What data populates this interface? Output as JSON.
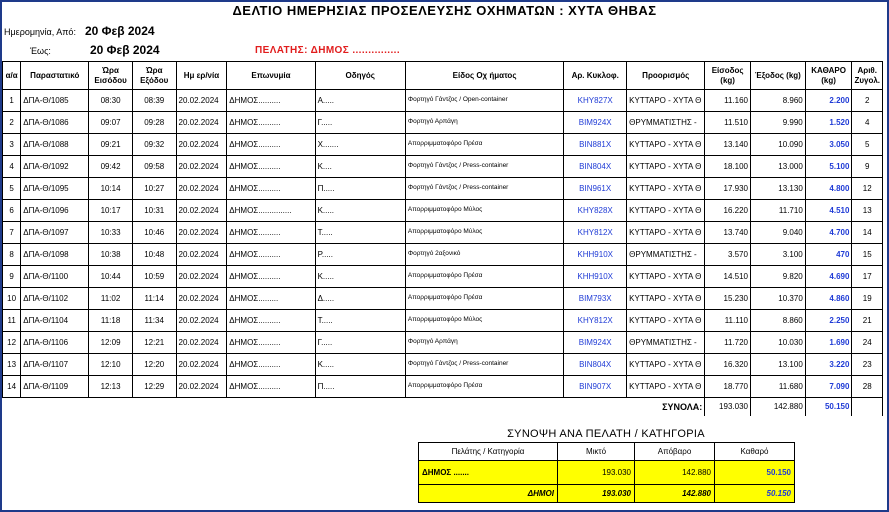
{
  "header": {
    "title": "ΔΕΛΤΙΟ ΗΜΕΡΗΣΙΑΣ ΠΡΟΣΕΛΕΥΣΗΣ ΟΧΗΜΑΤΩΝ :  ΧΥΤΑ ΘΗΒΑΣ",
    "from_label": "Ημερομηνία, Από:",
    "from_date": "20 Φεβ 2024",
    "to_label": "Έως:",
    "to_date": "20 Φεβ 2024",
    "client_text": "ΠΕΛΑΤΗΣ:  ΔΗΜΟΣ ..............."
  },
  "columns": [
    "α/α",
    "Παραστατικό",
    "Ώρα Εισόδου",
    "Ώρα Εξόδου",
    "Ημ ερ/νία",
    "Επωνυμία",
    "Οδηγός",
    "Είδος Οχ ήματος",
    "Αρ. Κυκλοφ.",
    "Προορισμός",
    "Είσοδος (kg)",
    "Έξοδος (kg)",
    "ΚΑΘΑΡΟ (kg)",
    "Αριθ. Ζυγολ."
  ],
  "rows": [
    {
      "aa": "1",
      "doc": "ΔΠΑ-Θ/1085",
      "in": "08:30",
      "out": "08:39",
      "date": "20.02.2024",
      "name": "ΔΗΜΟΣ..........",
      "driver": "Α.....",
      "vehicle": "Φορτηγό Γάντζος / Open-container",
      "plate": "ΚΗΥ827Χ",
      "dest": "ΚΥΤΤΑΡΟ - ΧΥΤΑ Θ",
      "in_kg": "11.160",
      "out_kg": "8.960",
      "net": "2.200",
      "scale": "2"
    },
    {
      "aa": "2",
      "doc": "ΔΠΑ-Θ/1086",
      "in": "09:07",
      "out": "09:28",
      "date": "20.02.2024",
      "name": "ΔΗΜΟΣ..........",
      "driver": "Γ.....",
      "vehicle": "Φορτηγό Αρπάγη",
      "plate": "ΒΙΜ924Χ",
      "dest": "ΘΡΥΜΜΑΤΙΣΤΗΣ -",
      "in_kg": "11.510",
      "out_kg": "9.990",
      "net": "1.520",
      "scale": "4"
    },
    {
      "aa": "3",
      "doc": "ΔΠΑ-Θ/1088",
      "in": "09:21",
      "out": "09:32",
      "date": "20.02.2024",
      "name": "ΔΗΜΟΣ..........",
      "driver": "Χ.......",
      "vehicle": "Απορριμματοφόρο Πρέσα",
      "plate": "ΒΙΝ881Χ",
      "dest": "ΚΥΤΤΑΡΟ - ΧΥΤΑ Θ",
      "in_kg": "13.140",
      "out_kg": "10.090",
      "net": "3.050",
      "scale": "5"
    },
    {
      "aa": "4",
      "doc": "ΔΠΑ-Θ/1092",
      "in": "09:42",
      "out": "09:58",
      "date": "20.02.2024",
      "name": "ΔΗΜΟΣ..........",
      "driver": "Κ....",
      "vehicle": "Φορτηγό Γάντζος / Press-container",
      "plate": "ΒΙΝ804Χ",
      "dest": "ΚΥΤΤΑΡΟ - ΧΥΤΑ Θ",
      "in_kg": "18.100",
      "out_kg": "13.000",
      "net": "5.100",
      "scale": "9"
    },
    {
      "aa": "5",
      "doc": "ΔΠΑ-Θ/1095",
      "in": "10:14",
      "out": "10:27",
      "date": "20.02.2024",
      "name": "ΔΗΜΟΣ..........",
      "driver": "Π.....",
      "vehicle": "Φορτηγό Γάντζος / Press-container",
      "plate": "ΒΙΝ961Χ",
      "dest": "ΚΥΤΤΑΡΟ - ΧΥΤΑ Θ",
      "in_kg": "17.930",
      "out_kg": "13.130",
      "net": "4.800",
      "scale": "12"
    },
    {
      "aa": "6",
      "doc": "ΔΠΑ-Θ/1096",
      "in": "10:17",
      "out": "10:31",
      "date": "20.02.2024",
      "name": "ΔΗΜΟΣ...............",
      "driver": "Κ.....",
      "vehicle": "Απορριμματοφόρο Μύλος",
      "plate": "ΚΗΥ828Χ",
      "dest": "ΚΥΤΤΑΡΟ - ΧΥΤΑ Θ",
      "in_kg": "16.220",
      "out_kg": "11.710",
      "net": "4.510",
      "scale": "13"
    },
    {
      "aa": "7",
      "doc": "ΔΠΑ-Θ/1097",
      "in": "10:33",
      "out": "10:46",
      "date": "20.02.2024",
      "name": "ΔΗΜΟΣ..........",
      "driver": "Τ.....",
      "vehicle": "Απορριμματοφόρο Μύλος",
      "plate": "ΚΗΥ812Χ",
      "dest": "ΚΥΤΤΑΡΟ - ΧΥΤΑ Θ",
      "in_kg": "13.740",
      "out_kg": "9.040",
      "net": "4.700",
      "scale": "14"
    },
    {
      "aa": "8",
      "doc": "ΔΠΑ-Θ/1098",
      "in": "10:38",
      "out": "10:48",
      "date": "20.02.2024",
      "name": "ΔΗΜΟΣ..........",
      "driver": "Ρ.....",
      "vehicle": "Φορτηγό 2αξονικό",
      "plate": "ΚΗΗ910Χ",
      "dest": "ΘΡΥΜΜΑΤΙΣΤΗΣ -",
      "in_kg": "3.570",
      "out_kg": "3.100",
      "net": "470",
      "scale": "15"
    },
    {
      "aa": "9",
      "doc": "ΔΠΑ-Θ/1100",
      "in": "10:44",
      "out": "10:59",
      "date": "20.02.2024",
      "name": "ΔΗΜΟΣ..........",
      "driver": "Κ.....",
      "vehicle": "Απορριμματοφόρο Πρέσα",
      "plate": "ΚΗΗ910Χ",
      "dest": "ΚΥΤΤΑΡΟ - ΧΥΤΑ Θ",
      "in_kg": "14.510",
      "out_kg": "9.820",
      "net": "4.690",
      "scale": "17"
    },
    {
      "aa": "10",
      "doc": "ΔΠΑ-Θ/1102",
      "in": "11:02",
      "out": "11:14",
      "date": "20.02.2024",
      "name": "ΔΗΜΟΣ.........",
      "driver": "Δ.....",
      "vehicle": "Απορριμματοφόρο Πρέσα",
      "plate": "ΒΙΜ793Χ",
      "dest": "ΚΥΤΤΑΡΟ - ΧΥΤΑ Θ",
      "in_kg": "15.230",
      "out_kg": "10.370",
      "net": "4.860",
      "scale": "19"
    },
    {
      "aa": "11",
      "doc": "ΔΠΑ-Θ/1104",
      "in": "11:18",
      "out": "11:34",
      "date": "20.02.2024",
      "name": "ΔΗΜΟΣ..........",
      "driver": "Τ.....",
      "vehicle": "Απορριμματοφόρο Μύλος",
      "plate": "ΚΗΥ812Χ",
      "dest": "ΚΥΤΤΑΡΟ - ΧΥΤΑ Θ",
      "in_kg": "11.110",
      "out_kg": "8.860",
      "net": "2.250",
      "scale": "21"
    },
    {
      "aa": "12",
      "doc": "ΔΠΑ-Θ/1106",
      "in": "12:09",
      "out": "12:21",
      "date": "20.02.2024",
      "name": "ΔΗΜΟΣ..........",
      "driver": "Γ.....",
      "vehicle": "Φορτηγό Αρπάγη",
      "plate": "ΒΙΜ924Χ",
      "dest": "ΘΡΥΜΜΑΤΙΣΤΗΣ -",
      "in_kg": "11.720",
      "out_kg": "10.030",
      "net": "1.690",
      "scale": "24"
    },
    {
      "aa": "13",
      "doc": "ΔΠΑ-Θ/1107",
      "in": "12:10",
      "out": "12:20",
      "date": "20.02.2024",
      "name": "ΔΗΜΟΣ..........",
      "driver": "Κ.....",
      "vehicle": "Φορτηγό Γάντζος / Press-container",
      "plate": "ΒΙΝ804Χ",
      "dest": "ΚΥΤΤΑΡΟ - ΧΥΤΑ Θ",
      "in_kg": "16.320",
      "out_kg": "13.100",
      "net": "3.220",
      "scale": "23"
    },
    {
      "aa": "14",
      "doc": "ΔΠΑ-Θ/1109",
      "in": "12:13",
      "out": "12:29",
      "date": "20.02.2024",
      "name": "ΔΗΜΟΣ..........",
      "driver": "Π.....",
      "vehicle": "Απορριμματοφόρο Πρέσα",
      "plate": "ΒΙΝ907Χ",
      "dest": "ΚΥΤΤΑΡΟ - ΧΥΤΑ Θ",
      "in_kg": "18.770",
      "out_kg": "11.680",
      "net": "7.090",
      "scale": "28"
    }
  ],
  "totals": {
    "label": "ΣΥΝΟΛΑ:",
    "in_kg": "193.030",
    "out_kg": "142.880",
    "net": "50.150"
  },
  "summary": {
    "title": "ΣΥΝΟΨΗ ΑΝΑ ΠΕΛΑΤΗ / ΚΑΤΗΓΟΡΙΑ",
    "headers": [
      "Πελάτης / Κατηγορία",
      "Μικτό",
      "Απόβαρο",
      "Καθαρό"
    ],
    "row": {
      "client": "ΔΗΜΟΣ .......",
      "gross": "193.030",
      "tare": "142.880",
      "net": "50.150"
    },
    "total": {
      "label": "ΔΗΜΟΙ",
      "gross": "193.030",
      "tare": "142.880",
      "net": "50.150"
    }
  },
  "colors": {
    "border": "#1e3a8a",
    "accent_blue": "#1f3bd6",
    "client_red": "#e11d1d",
    "highlight_yellow": "#ffff00"
  }
}
